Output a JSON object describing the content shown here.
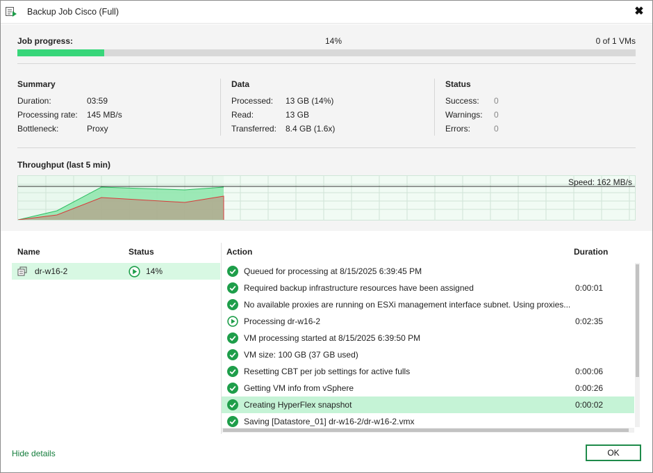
{
  "window": {
    "title": "Backup Job Cisco (Full)",
    "close_glyph": "✖"
  },
  "progress": {
    "label": "Job progress:",
    "percent_text": "14%",
    "percent_value": 14,
    "vms_text": "0 of 1 VMs"
  },
  "summary": {
    "title": "Summary",
    "rows": [
      {
        "label": "Duration:",
        "value": "03:59"
      },
      {
        "label": "Processing rate:",
        "value": "145 MB/s"
      },
      {
        "label": "Bottleneck:",
        "value": "Proxy"
      }
    ]
  },
  "data_section": {
    "title": "Data",
    "rows": [
      {
        "label": "Processed:",
        "value": "13 GB (14%)"
      },
      {
        "label": "Read:",
        "value": "13 GB"
      },
      {
        "label": "Transferred:",
        "value": "8.4 GB (1.6x)"
      }
    ]
  },
  "status_section": {
    "title": "Status",
    "rows": [
      {
        "label": "Success:",
        "value": "0"
      },
      {
        "label": "Warnings:",
        "value": "0"
      },
      {
        "label": "Errors:",
        "value": "0"
      }
    ]
  },
  "throughput": {
    "title": "Throughput (last 5 min)",
    "speed_text": "Speed: 162 MB/s"
  },
  "table": {
    "headers": {
      "name": "Name",
      "status": "Status",
      "action": "Action",
      "duration": "Duration"
    },
    "vms": [
      {
        "name": "dr-w16-2",
        "status": "14%",
        "icon": "vm-icon",
        "status_icon": "play-circle-icon"
      }
    ],
    "actions": [
      {
        "text": "Queued for processing at 8/15/2025 6:39:45 PM",
        "duration": "",
        "icon": "check-circle-icon"
      },
      {
        "text": "Required backup infrastructure resources have been assigned",
        "duration": "0:00:01",
        "icon": "check-circle-icon"
      },
      {
        "text": "No available proxies are running on ESXi management interface subnet. Using proxies...",
        "duration": "",
        "icon": "check-circle-icon"
      },
      {
        "text": "Processing dr-w16-2",
        "duration": "0:02:35",
        "icon": "play-circle-icon"
      },
      {
        "text": "VM processing started at 8/15/2025 6:39:50 PM",
        "duration": "",
        "icon": "check-circle-icon"
      },
      {
        "text": "VM size: 100 GB (37 GB used)",
        "duration": "",
        "icon": "check-circle-icon"
      },
      {
        "text": "Resetting CBT per job settings for active fulls",
        "duration": "0:00:06",
        "icon": "check-circle-icon"
      },
      {
        "text": "Getting VM info from vSphere",
        "duration": "0:00:26",
        "icon": "check-circle-icon"
      },
      {
        "text": "Creating HyperFlex snapshot",
        "duration": "0:00:02",
        "icon": "check-circle-icon",
        "selected": true
      },
      {
        "text": "Saving [Datastore_01] dr-w16-2/dr-w16-2.vmx",
        "duration": "",
        "icon": "check-circle-icon"
      }
    ]
  },
  "footer": {
    "hide_details": "Hide details",
    "ok": "OK"
  },
  "colors": {
    "accent_green": "#1e9e4a",
    "progress_fill": "#38d67a",
    "selected_row": "#c5f3d6"
  }
}
